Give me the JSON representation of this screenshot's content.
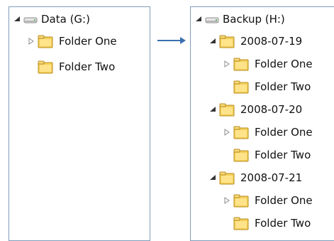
{
  "source": {
    "drive_label": "Data (G:)",
    "folders": [
      "Folder One",
      "Folder Two"
    ]
  },
  "dest": {
    "drive_label": "Backup (H:)",
    "dates": [
      {
        "label": "2008-07-19",
        "folders": [
          "Folder One",
          "Folder Two"
        ]
      },
      {
        "label": "2008-07-20",
        "folders": [
          "Folder One",
          "Folder Two"
        ]
      },
      {
        "label": "2008-07-21",
        "folders": [
          "Folder One",
          "Folder Two"
        ]
      }
    ]
  },
  "colors": {
    "pane_border": "#7f9db9",
    "arrow": "#3a6fb0",
    "folder_yellow": "#f3cf5a",
    "expander": "#333333"
  },
  "icons": {
    "drive": "drive-icon",
    "folder": "folder-icon",
    "expanded": "triangle-down-icon",
    "collapsed": "triangle-right-icon"
  }
}
